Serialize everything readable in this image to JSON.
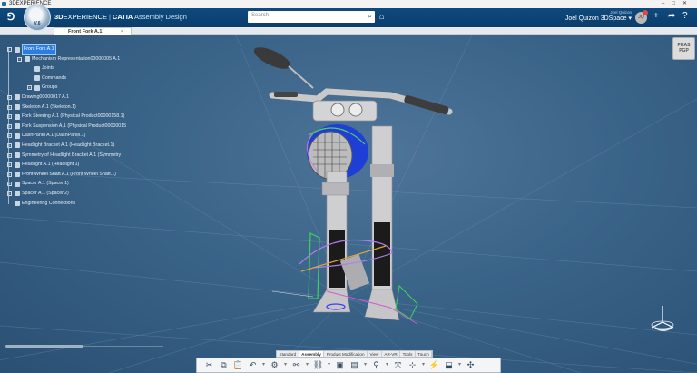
{
  "window": {
    "title": "3DEXPERIENCE"
  },
  "header": {
    "brand_3d": "3D",
    "brand_experience": "EXPERIENCE",
    "brand_product": "CATIA",
    "brand_app": "Assembly Design",
    "compass_label": "V,6",
    "search_placeholder": "Search",
    "user_role": "Joel Quizon",
    "user_name": "Joel Quizon 3DSpace",
    "avatar_initials": "JQ"
  },
  "tab": {
    "label": "Front Fork A.1"
  },
  "tree": {
    "items": [
      {
        "label": "Front Fork A.1",
        "indent": 1,
        "selected": true,
        "expander": "−"
      },
      {
        "label": "Mechanism Representation00000005 A.1",
        "indent": 2,
        "expander": "−"
      },
      {
        "label": "Joints",
        "indent": 3,
        "expander": ""
      },
      {
        "label": "Commands",
        "indent": 3,
        "expander": ""
      },
      {
        "label": "Groups",
        "indent": 3,
        "expander": "+"
      },
      {
        "label": "Drawing00000017 A.1",
        "indent": 1,
        "expander": "+"
      },
      {
        "label": "Skeleton A.1 (Skeleton.1)",
        "indent": 1,
        "expander": "+"
      },
      {
        "label": "Fork Steering A.1 (Physical Product00000158.1)",
        "indent": 1,
        "expander": "+"
      },
      {
        "label": "Fork Suspension A.1 (Physical Product00000015",
        "indent": 1,
        "expander": "+"
      },
      {
        "label": "DashPanel A.1 (DashPanel.1)",
        "indent": 1,
        "expander": "+"
      },
      {
        "label": "Headlight Bracket A.1 (Headlight Bracket.1)",
        "indent": 1,
        "expander": "+"
      },
      {
        "label": "Symmetry of Headlight Bracket A.1 (Symmetry",
        "indent": 1,
        "expander": "+"
      },
      {
        "label": "Headlight A.1 (Headlight.1)",
        "indent": 1,
        "expander": "+"
      },
      {
        "label": "Front Wheel Shaft A.1 (Front Wheel Shaft.1)",
        "indent": 1,
        "expander": "+"
      },
      {
        "label": "Spacer A.1 (Spacer.1)",
        "indent": 1,
        "expander": "+"
      },
      {
        "label": "Spacer A.1 (Spacer.2)",
        "indent": 1,
        "expander": "+"
      },
      {
        "label": "Engineering Connections",
        "indent": 1,
        "expander": ""
      }
    ]
  },
  "widgets": {
    "pgp_line1": "PHAS",
    "pgp_line2": "PGP"
  },
  "section_tabs": [
    "Standard",
    "Assembly",
    "Product Modification",
    "View",
    "AR-VR",
    "Tools",
    "Touch"
  ],
  "active_section": "Assembly",
  "tools": [
    {
      "name": "cut-icon",
      "glyph": "✂"
    },
    {
      "name": "copy-icon",
      "glyph": "⧉"
    },
    {
      "name": "paste-icon",
      "glyph": "📋"
    },
    {
      "name": "undo-icon",
      "glyph": "↶"
    },
    {
      "name": "more-icon",
      "glyph": "▾",
      "small": true
    },
    {
      "name": "settings-icon",
      "glyph": "⚙"
    },
    {
      "name": "more-icon",
      "glyph": "▾",
      "small": true
    },
    {
      "name": "engineering-connection-icon",
      "glyph": "⚯"
    },
    {
      "name": "more-icon",
      "glyph": "▾",
      "small": true
    },
    {
      "name": "constraint-icon",
      "glyph": "⛓"
    },
    {
      "name": "more-icon",
      "glyph": "▾",
      "small": true
    },
    {
      "name": "assemble-icon",
      "glyph": "▣"
    },
    {
      "name": "pattern-icon",
      "glyph": "▤"
    },
    {
      "name": "more-icon",
      "glyph": "▾",
      "small": true
    },
    {
      "name": "robot-icon",
      "glyph": "⚲"
    },
    {
      "name": "more-icon",
      "glyph": "▾",
      "small": true
    },
    {
      "name": "axis-icon",
      "glyph": "⤧"
    },
    {
      "name": "measure-icon",
      "glyph": "⊹"
    },
    {
      "name": "more-icon",
      "glyph": "▾",
      "small": true
    },
    {
      "name": "clash-icon",
      "glyph": "⚡"
    },
    {
      "name": "section-icon",
      "glyph": "⬓"
    },
    {
      "name": "more-icon",
      "glyph": "▾",
      "small": true
    },
    {
      "name": "explode-icon",
      "glyph": "✣"
    }
  ],
  "colors": {
    "header_bg": "#0e4a7e",
    "viewport_bg": "#3a6388",
    "selection": "#2d7de0",
    "fork_body": "#c8c8cc",
    "headlight_blue": "#1e3fd6"
  }
}
